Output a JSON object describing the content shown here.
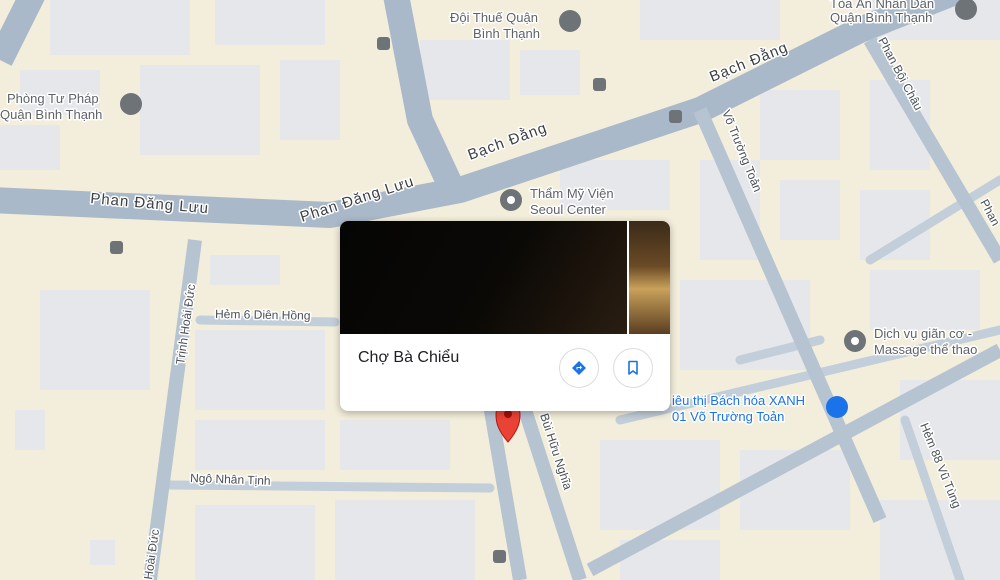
{
  "place_card": {
    "title": "Chợ Bà Chiểu",
    "directions_icon": "directions-icon",
    "save_icon": "bookmark-icon"
  },
  "streets": {
    "phan_dang_luu_west": "Phan Đăng Lưu",
    "phan_dang_luu_east": "Phan Đăng Lưu",
    "bach_dang_1": "Bạch Đằng",
    "bach_dang_2": "Bạch Đằng",
    "vo_truong_toan": "Võ Trường Toản",
    "phan_boi_chau": "Phan Bội Châu",
    "phan_edge": "Phan",
    "trinh_hoai_duc_1": "Trịnh Hoài Đức",
    "trinh_hoai_duc_2": "Hoài Đức",
    "bui_huu_nghia": "Bùi Hữu Nghĩa",
    "ngo_nhan_tinh": "Ngô Nhân Tịnh",
    "hem_6": "Hẻm 6 Diên Hồng",
    "hem_88": "Hẻm 88 Vũ Tùng"
  },
  "pois": {
    "phong_tu_phap_1": "Phòng Tư Pháp",
    "phong_tu_phap_2": "Quận Bình Thạnh",
    "doi_thue_1": "Đội Thuế Quận",
    "doi_thue_2": "Bình Thạnh",
    "toa_an_1": "Tòa Án Nhân Dân",
    "toa_an_2": "Quận Bình Thạnh",
    "tham_my_1": "Thẩm Mỹ Viện",
    "tham_my_2": "Seoul Center",
    "dich_vu_1": "Dịch vụ giãn cơ -",
    "dich_vu_2": "Massage thể thao",
    "bach_hoa_1": "iêu thị Bách hóa XANH",
    "bach_hoa_2": "01 Võ Trường Toản"
  },
  "colors": {
    "land": "#f3eedb",
    "building": "#e8eaed",
    "road": "#aab9c9",
    "road_minor": "#c2ced9",
    "pin": "#ea4335",
    "poi_gray": "#6e7378",
    "poi_blue": "#1a73e8"
  }
}
